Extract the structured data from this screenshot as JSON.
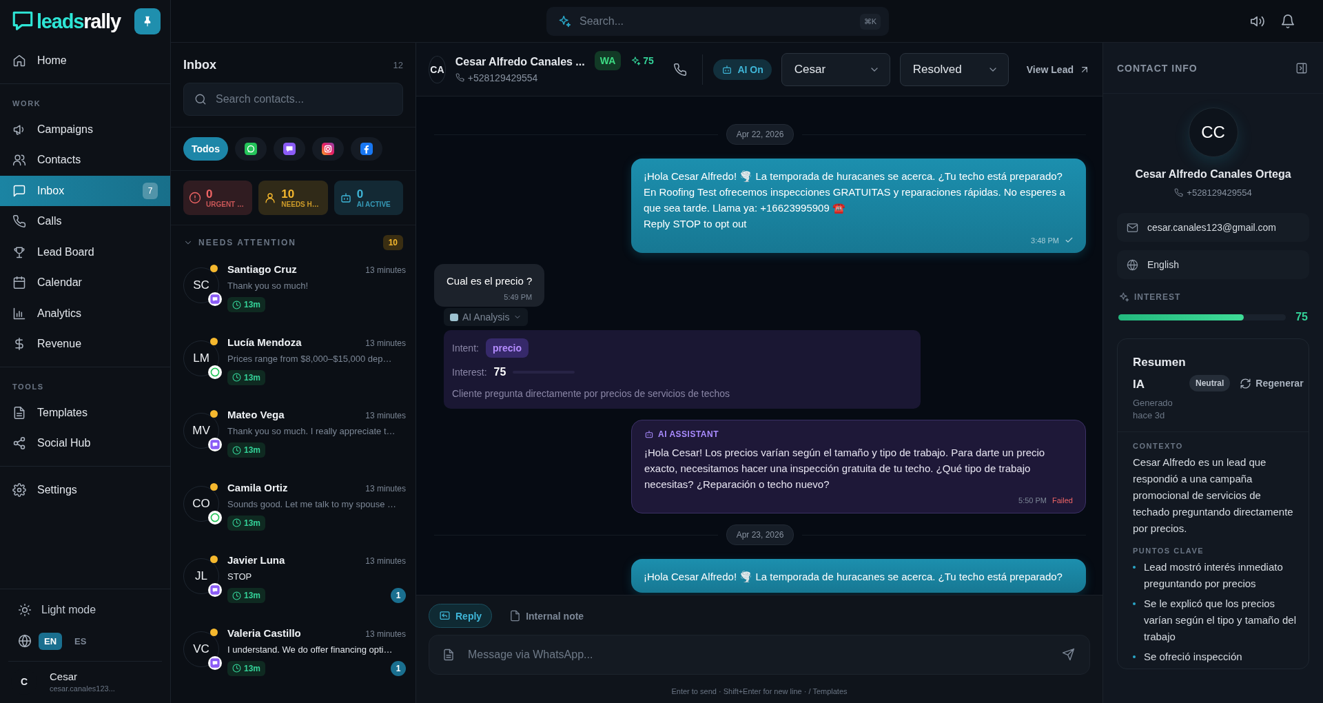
{
  "logo": {
    "text_1": "leads",
    "text_2": "rally"
  },
  "sidebar": {
    "sections": [
      {
        "items": [
          {
            "label": "Home",
            "selected": false
          }
        ]
      },
      {
        "label": "WORK",
        "items": [
          {
            "label": "Campaigns",
            "selected": false
          },
          {
            "label": "Contacts",
            "selected": false
          },
          {
            "label": "Inbox",
            "selected": true,
            "badge": "7"
          },
          {
            "label": "Calls",
            "selected": false
          },
          {
            "label": "Lead Board",
            "selected": false
          },
          {
            "label": "Calendar",
            "selected": false
          },
          {
            "label": "Analytics",
            "selected": false
          },
          {
            "label": "Revenue",
            "selected": false
          }
        ]
      },
      {
        "label": "TOOLS",
        "items": [
          {
            "label": "Templates",
            "selected": false
          },
          {
            "label": "Social Hub",
            "selected": false
          }
        ]
      },
      {
        "items": [
          {
            "label": "Settings",
            "selected": false
          }
        ]
      }
    ],
    "theme_toggle": "Light mode",
    "languages": [
      {
        "label": "EN",
        "selected": true
      },
      {
        "label": "ES",
        "selected": false
      }
    ],
    "user": {
      "initial": "C",
      "name": "Cesar",
      "email": "cesar.canales123..."
    }
  },
  "top_bar": {
    "search": {
      "placeholder": "Search...",
      "shortcut": "⌘K"
    }
  },
  "inbox": {
    "title": "Inbox",
    "count": "12",
    "search": {
      "placeholder": "Search contacts..."
    },
    "filters": [
      {
        "kind": "all",
        "label": "Todos",
        "selected": true
      },
      {
        "kind": "whatsapp",
        "selected": false
      },
      {
        "kind": "sms",
        "selected": false
      },
      {
        "kind": "instagram",
        "selected": false
      },
      {
        "kind": "facebook",
        "selected": false
      }
    ],
    "stats": [
      {
        "kind": "urgent",
        "value": "0",
        "label": "URGENT …",
        "color": "#f06565"
      },
      {
        "kind": "needs_human",
        "value": "10",
        "label": "NEEDS H…",
        "color": "#f5b82e"
      },
      {
        "kind": "ai_active",
        "value": "0",
        "label": "AI ACTIVE",
        "color": "#3fb6d8"
      }
    ],
    "section": {
      "title": "NEEDS ATTENTION",
      "count": "10",
      "expanded": true
    },
    "conversations": [
      {
        "initials": "SC",
        "name": "Santiago Cruz",
        "time": "13 minutes",
        "preview": "Thank you so much!",
        "kind": "sms",
        "wait": "13m",
        "unread": false
      },
      {
        "initials": "LM",
        "name": "Lucía Mendoza",
        "time": "13 minutes",
        "preview": "Prices range from $8,000–$15,000 dep…",
        "kind": "whatsapp",
        "wait": "13m",
        "unread": false
      },
      {
        "initials": "MV",
        "name": "Mateo Vega",
        "time": "13 minutes",
        "preview": "Thank you so much. I really appreciate t…",
        "kind": "sms",
        "wait": "13m",
        "unread": false
      },
      {
        "initials": "CO",
        "name": "Camila Ortiz",
        "time": "13 minutes",
        "preview": "Sounds good. Let me talk to my spouse …",
        "kind": "whatsapp",
        "wait": "13m",
        "unread": false
      },
      {
        "initials": "JL",
        "name": "Javier Luna",
        "time": "13 minutes",
        "preview": "STOP",
        "kind": "sms",
        "wait": "13m",
        "unread": true,
        "unread_count": "1"
      },
      {
        "initials": "VC",
        "name": "Valeria Castillo",
        "time": "13 minutes",
        "preview": "I understand. We do offer financing opti…",
        "kind": "sms",
        "wait": "13m",
        "unread": true,
        "unread_count": "1"
      }
    ]
  },
  "chat": {
    "header": {
      "initials": "CA",
      "name": "Cesar Alfredo Canales ...",
      "phone": "+528129429554",
      "channel": "WA",
      "score": "75",
      "ai": {
        "label": "AI On",
        "on": true
      },
      "assignee": "Cesar",
      "status": "Resolved",
      "view_lead": "View Lead"
    },
    "messages": [
      {
        "kind": "date",
        "text": "Apr 22, 2026"
      },
      {
        "kind": "outgoing",
        "text": "¡Hola Cesar Alfredo! 🌪️ La temporada de huracanes se acerca. ¿Tu techo está preparado? En Roofing Test ofrecemos inspecciones GRATUITAS y reparaciones rápidas. No esperes a que sea tarde. Llama ya: +16623995909 ☎️\nReply STOP to opt out",
        "time": "3:48 PM",
        "delivered": true
      },
      {
        "kind": "incoming",
        "text": "Cual es el precio ?",
        "time": "5:49 PM"
      },
      {
        "kind": "analysis",
        "toggle": "AI Analysis",
        "expanded": true,
        "intent_label": "Intent:",
        "intent": "precio",
        "interest_label": "Interest:",
        "interest": "75",
        "summary": "Cliente pregunta directamente por precios de servicios de techos"
      },
      {
        "kind": "ai",
        "label": "AI ASSISTANT",
        "text": "¡Hola Cesar! Los precios varían según el tamaño y tipo de trabajo. Para darte un precio exacto, necesitamos hacer una inspección gratuita de tu techo. ¿Qué tipo de trabajo necesitas? ¿Reparación o techo nuevo?",
        "time": "5:50 PM",
        "status": "Failed"
      },
      {
        "kind": "date",
        "text": "Apr 23, 2026"
      },
      {
        "kind": "outgoing",
        "text": "¡Hola Cesar Alfredo! 🌪️ La temporada de huracanes se acerca. ¿Tu techo está preparado?"
      }
    ],
    "composer": {
      "tabs": [
        {
          "label": "Reply",
          "selected": true
        },
        {
          "label": "Internal note",
          "selected": false
        }
      ],
      "placeholder": "Message via WhatsApp...",
      "hint": "Enter to send · Shift+Enter for new line · / Templates"
    }
  },
  "contact": {
    "title": "CONTACT INFO",
    "initials": "CC",
    "name": "Cesar Alfredo Canales Ortega",
    "phone": "+528129429554",
    "email": "cesar.canales123@gmail.com",
    "language": "English",
    "interest": {
      "label": "INTEREST",
      "level": 0.75,
      "reading": "75"
    },
    "summary": {
      "title": "Resumen IA",
      "sentiment": "Neutral",
      "regenerate": "Regenerar",
      "generated": "Generado hace 3d",
      "context_label": "CONTEXTO",
      "context": "Cesar Alfredo es un lead que respondió a una campaña promocional de servicios de techado preguntando directamente por precios.",
      "points_label": "PUNTOS CLAVE",
      "points": [
        "Lead mostró interés inmediato preguntando por precios",
        "Se le explicó que los precios varían según el tipo y tamaño del trabajo",
        "Se ofreció inspección"
      ]
    }
  }
}
